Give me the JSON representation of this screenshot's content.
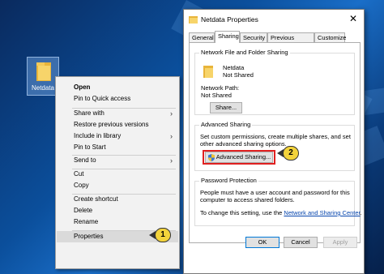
{
  "desktop": {
    "icon_label": "Netdata"
  },
  "context_menu": {
    "items": [
      {
        "label": "Open",
        "bold": true,
        "submenu": false
      },
      {
        "label": "Pin to Quick access",
        "bold": false,
        "submenu": false
      },
      {
        "label": "Share with",
        "bold": false,
        "submenu": true
      },
      {
        "label": "Restore previous versions",
        "bold": false,
        "submenu": false
      },
      {
        "label": "Include in library",
        "bold": false,
        "submenu": true
      },
      {
        "label": "Pin to Start",
        "bold": false,
        "submenu": false
      },
      {
        "label": "Send to",
        "bold": false,
        "submenu": true
      },
      {
        "label": "Cut",
        "bold": false,
        "submenu": false
      },
      {
        "label": "Copy",
        "bold": false,
        "submenu": false
      },
      {
        "label": "Create shortcut",
        "bold": false,
        "submenu": false
      },
      {
        "label": "Delete",
        "bold": false,
        "submenu": false
      },
      {
        "label": "Rename",
        "bold": false,
        "submenu": false
      },
      {
        "label": "Properties",
        "bold": false,
        "submenu": false
      }
    ],
    "highlighted": "Properties"
  },
  "annotations": {
    "step1": "1",
    "step2": "2",
    "badge_color": "#f3d33b",
    "box_color": "#e02020"
  },
  "dialog": {
    "title": "Netdata Properties",
    "close_glyph": "✕",
    "tabs": [
      "General",
      "Sharing",
      "Security",
      "Previous Versions",
      "Customize"
    ],
    "active_tab": "Sharing",
    "network_sharing": {
      "heading": "Network File and Folder Sharing",
      "name": "Netdata",
      "status": "Not Shared",
      "path_label": "Network Path:",
      "path_value": "Not Shared",
      "share_button": "Share..."
    },
    "advanced_sharing": {
      "heading": "Advanced Sharing",
      "description": "Set custom permissions, create multiple shares, and set other advanced sharing options.",
      "button": "Advanced Sharing..."
    },
    "password_protection": {
      "heading": "Password Protection",
      "description": "People must have a user account and password for this computer to access shared folders.",
      "change_prefix": "To change this setting, use the ",
      "link": "Network and Sharing Center",
      "change_suffix": "."
    },
    "buttons": {
      "ok": "OK",
      "cancel": "Cancel",
      "apply": "Apply"
    }
  }
}
